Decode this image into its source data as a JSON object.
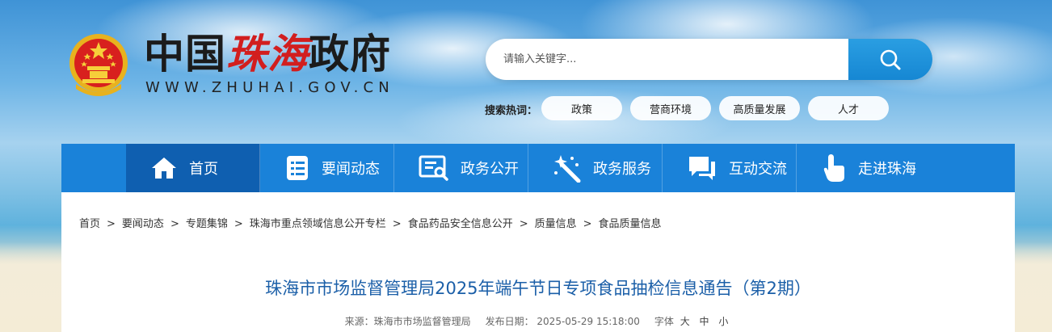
{
  "header": {
    "title_black_1": "中国",
    "title_red": "珠海",
    "title_black_2": "政府",
    "url": "WWW.ZHUHAI.GOV.CN"
  },
  "search": {
    "placeholder": "请输入关键字..."
  },
  "hot_words": {
    "label": "搜索热词：",
    "tags": [
      "政策",
      "营商环境",
      "高质量发展",
      "人才"
    ]
  },
  "nav": {
    "items": [
      {
        "label": "首页",
        "icon": "home-icon"
      },
      {
        "label": "要闻动态",
        "icon": "news-list-icon"
      },
      {
        "label": "政务公开",
        "icon": "document-search-icon"
      },
      {
        "label": "政务服务",
        "icon": "magic-wand-icon"
      },
      {
        "label": "互动交流",
        "icon": "chat-icon"
      },
      {
        "label": "走进珠海",
        "icon": "pointer-hand-icon"
      }
    ]
  },
  "breadcrumb": {
    "items": [
      "首页",
      "要闻动态",
      "专题集锦",
      "珠海市重点领域信息公开专栏",
      "食品药品安全信息公开",
      "质量信息",
      "食品质量信息"
    ],
    "separator": ">"
  },
  "article": {
    "title": "珠海市市场监督管理局2025年端午节日专项食品抽检信息通告（第2期）",
    "source": "来源：珠海市市场监督管理局",
    "date": "发布日期： 2025-05-29 15:18:00",
    "font_label": "字体",
    "font_sizes": [
      "大",
      "中",
      "小"
    ]
  },
  "colors": {
    "nav_bg": "#1a82d9",
    "nav_active": "#0f5fb0",
    "title_blue": "#1b5fa8",
    "brand_red": "#d21e1e"
  }
}
